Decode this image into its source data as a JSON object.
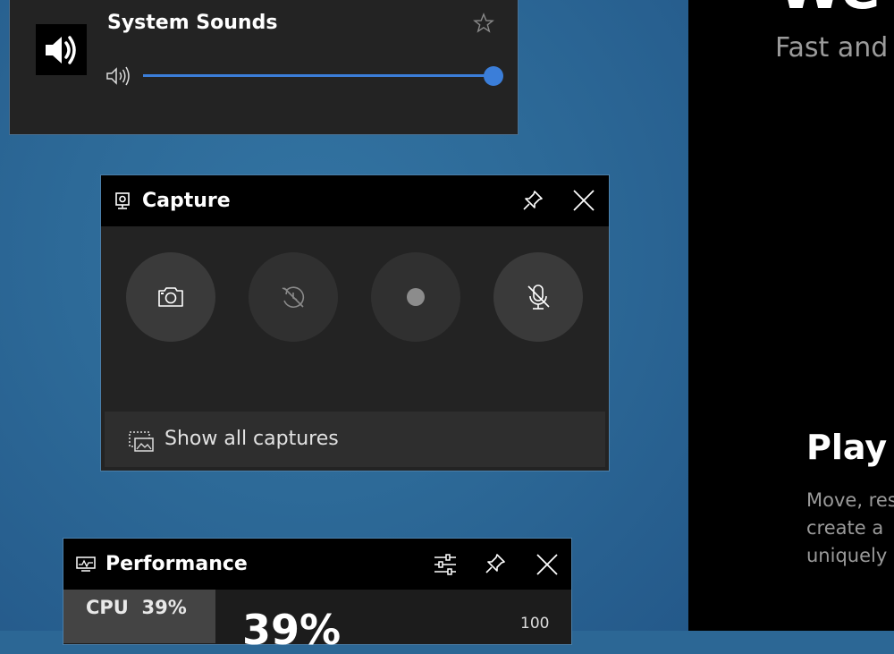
{
  "background": {
    "partial_heading": "We",
    "tagline": "Fast and c",
    "play_heading": "Play y",
    "body_lines": [
      "Move, res",
      "create a",
      "uniquely"
    ]
  },
  "system_sounds": {
    "title": "System Sounds",
    "volume": 1.0,
    "accent_color": "#3b7ed9"
  },
  "capture": {
    "title": "Capture",
    "buttons": [
      {
        "name": "screenshot",
        "icon": "camera-icon"
      },
      {
        "name": "record-last-30s",
        "icon": "replay-disabled-icon"
      },
      {
        "name": "start-recording",
        "icon": "record-dot-icon"
      },
      {
        "name": "microphone",
        "icon": "mic-off-icon"
      }
    ],
    "show_all_label": "Show all captures"
  },
  "performance": {
    "title": "Performance",
    "cpu_label": "CPU",
    "cpu_value": "39%",
    "big_value": "39%",
    "scale_max": "100"
  }
}
